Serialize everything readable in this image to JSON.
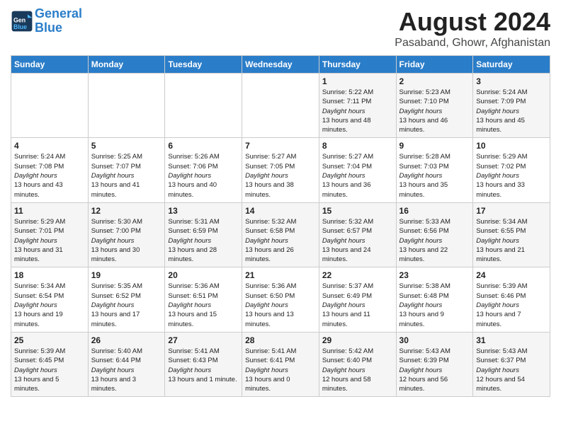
{
  "header": {
    "logo_line1": "General",
    "logo_line2": "Blue",
    "month_year": "August 2024",
    "location": "Pasaband, Ghowr, Afghanistan"
  },
  "days_of_week": [
    "Sunday",
    "Monday",
    "Tuesday",
    "Wednesday",
    "Thursday",
    "Friday",
    "Saturday"
  ],
  "weeks": [
    [
      {
        "num": "",
        "sunrise": "",
        "sunset": "",
        "daylight": ""
      },
      {
        "num": "",
        "sunrise": "",
        "sunset": "",
        "daylight": ""
      },
      {
        "num": "",
        "sunrise": "",
        "sunset": "",
        "daylight": ""
      },
      {
        "num": "",
        "sunrise": "",
        "sunset": "",
        "daylight": ""
      },
      {
        "num": "1",
        "sunrise": "Sunrise: 5:22 AM",
        "sunset": "Sunset: 7:11 PM",
        "daylight": "Daylight: 13 hours and 48 minutes."
      },
      {
        "num": "2",
        "sunrise": "Sunrise: 5:23 AM",
        "sunset": "Sunset: 7:10 PM",
        "daylight": "Daylight: 13 hours and 46 minutes."
      },
      {
        "num": "3",
        "sunrise": "Sunrise: 5:24 AM",
        "sunset": "Sunset: 7:09 PM",
        "daylight": "Daylight: 13 hours and 45 minutes."
      }
    ],
    [
      {
        "num": "4",
        "sunrise": "Sunrise: 5:24 AM",
        "sunset": "Sunset: 7:08 PM",
        "daylight": "Daylight: 13 hours and 43 minutes."
      },
      {
        "num": "5",
        "sunrise": "Sunrise: 5:25 AM",
        "sunset": "Sunset: 7:07 PM",
        "daylight": "Daylight: 13 hours and 41 minutes."
      },
      {
        "num": "6",
        "sunrise": "Sunrise: 5:26 AM",
        "sunset": "Sunset: 7:06 PM",
        "daylight": "Daylight: 13 hours and 40 minutes."
      },
      {
        "num": "7",
        "sunrise": "Sunrise: 5:27 AM",
        "sunset": "Sunset: 7:05 PM",
        "daylight": "Daylight: 13 hours and 38 minutes."
      },
      {
        "num": "8",
        "sunrise": "Sunrise: 5:27 AM",
        "sunset": "Sunset: 7:04 PM",
        "daylight": "Daylight: 13 hours and 36 minutes."
      },
      {
        "num": "9",
        "sunrise": "Sunrise: 5:28 AM",
        "sunset": "Sunset: 7:03 PM",
        "daylight": "Daylight: 13 hours and 35 minutes."
      },
      {
        "num": "10",
        "sunrise": "Sunrise: 5:29 AM",
        "sunset": "Sunset: 7:02 PM",
        "daylight": "Daylight: 13 hours and 33 minutes."
      }
    ],
    [
      {
        "num": "11",
        "sunrise": "Sunrise: 5:29 AM",
        "sunset": "Sunset: 7:01 PM",
        "daylight": "Daylight: 13 hours and 31 minutes."
      },
      {
        "num": "12",
        "sunrise": "Sunrise: 5:30 AM",
        "sunset": "Sunset: 7:00 PM",
        "daylight": "Daylight: 13 hours and 30 minutes."
      },
      {
        "num": "13",
        "sunrise": "Sunrise: 5:31 AM",
        "sunset": "Sunset: 6:59 PM",
        "daylight": "Daylight: 13 hours and 28 minutes."
      },
      {
        "num": "14",
        "sunrise": "Sunrise: 5:32 AM",
        "sunset": "Sunset: 6:58 PM",
        "daylight": "Daylight: 13 hours and 26 minutes."
      },
      {
        "num": "15",
        "sunrise": "Sunrise: 5:32 AM",
        "sunset": "Sunset: 6:57 PM",
        "daylight": "Daylight: 13 hours and 24 minutes."
      },
      {
        "num": "16",
        "sunrise": "Sunrise: 5:33 AM",
        "sunset": "Sunset: 6:56 PM",
        "daylight": "Daylight: 13 hours and 22 minutes."
      },
      {
        "num": "17",
        "sunrise": "Sunrise: 5:34 AM",
        "sunset": "Sunset: 6:55 PM",
        "daylight": "Daylight: 13 hours and 21 minutes."
      }
    ],
    [
      {
        "num": "18",
        "sunrise": "Sunrise: 5:34 AM",
        "sunset": "Sunset: 6:54 PM",
        "daylight": "Daylight: 13 hours and 19 minutes."
      },
      {
        "num": "19",
        "sunrise": "Sunrise: 5:35 AM",
        "sunset": "Sunset: 6:52 PM",
        "daylight": "Daylight: 13 hours and 17 minutes."
      },
      {
        "num": "20",
        "sunrise": "Sunrise: 5:36 AM",
        "sunset": "Sunset: 6:51 PM",
        "daylight": "Daylight: 13 hours and 15 minutes."
      },
      {
        "num": "21",
        "sunrise": "Sunrise: 5:36 AM",
        "sunset": "Sunset: 6:50 PM",
        "daylight": "Daylight: 13 hours and 13 minutes."
      },
      {
        "num": "22",
        "sunrise": "Sunrise: 5:37 AM",
        "sunset": "Sunset: 6:49 PM",
        "daylight": "Daylight: 13 hours and 11 minutes."
      },
      {
        "num": "23",
        "sunrise": "Sunrise: 5:38 AM",
        "sunset": "Sunset: 6:48 PM",
        "daylight": "Daylight: 13 hours and 9 minutes."
      },
      {
        "num": "24",
        "sunrise": "Sunrise: 5:39 AM",
        "sunset": "Sunset: 6:46 PM",
        "daylight": "Daylight: 13 hours and 7 minutes."
      }
    ],
    [
      {
        "num": "25",
        "sunrise": "Sunrise: 5:39 AM",
        "sunset": "Sunset: 6:45 PM",
        "daylight": "Daylight: 13 hours and 5 minutes."
      },
      {
        "num": "26",
        "sunrise": "Sunrise: 5:40 AM",
        "sunset": "Sunset: 6:44 PM",
        "daylight": "Daylight: 13 hours and 3 minutes."
      },
      {
        "num": "27",
        "sunrise": "Sunrise: 5:41 AM",
        "sunset": "Sunset: 6:43 PM",
        "daylight": "Daylight: 13 hours and 1 minute."
      },
      {
        "num": "28",
        "sunrise": "Sunrise: 5:41 AM",
        "sunset": "Sunset: 6:41 PM",
        "daylight": "Daylight: 13 hours and 0 minutes."
      },
      {
        "num": "29",
        "sunrise": "Sunrise: 5:42 AM",
        "sunset": "Sunset: 6:40 PM",
        "daylight": "Daylight: 12 hours and 58 minutes."
      },
      {
        "num": "30",
        "sunrise": "Sunrise: 5:43 AM",
        "sunset": "Sunset: 6:39 PM",
        "daylight": "Daylight: 12 hours and 56 minutes."
      },
      {
        "num": "31",
        "sunrise": "Sunrise: 5:43 AM",
        "sunset": "Sunset: 6:37 PM",
        "daylight": "Daylight: 12 hours and 54 minutes."
      }
    ]
  ]
}
